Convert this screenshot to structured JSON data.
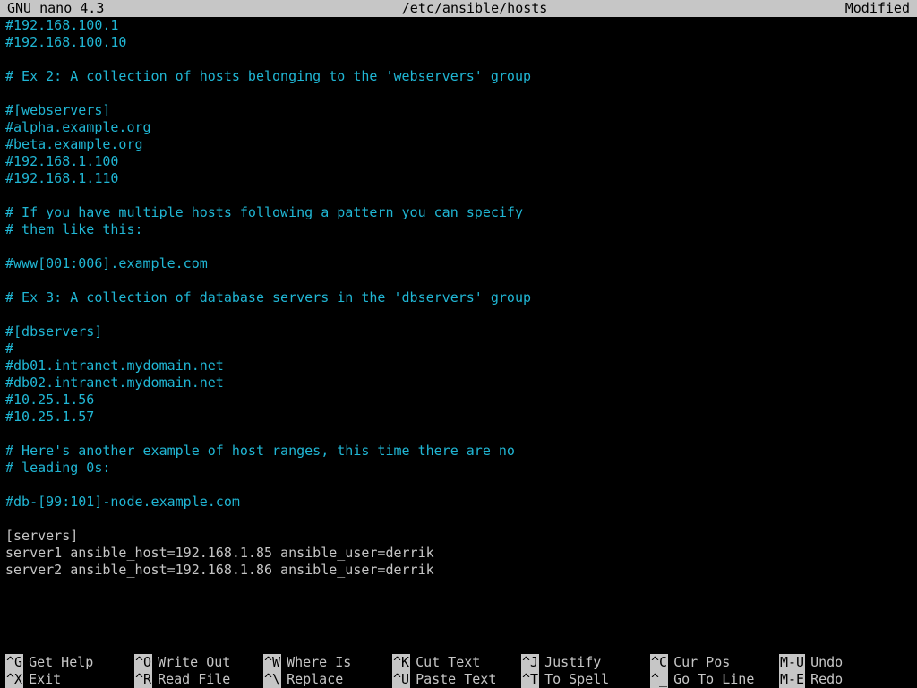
{
  "titlebar": {
    "app": "GNU nano 4.3",
    "file": "/etc/ansible/hosts",
    "state": "Modified"
  },
  "lines": [
    {
      "cls": "comment",
      "text": "#192.168.100.1"
    },
    {
      "cls": "comment",
      "text": "#192.168.100.10"
    },
    {
      "cls": "",
      "text": ""
    },
    {
      "cls": "comment",
      "text": "# Ex 2: A collection of hosts belonging to the 'webservers' group"
    },
    {
      "cls": "",
      "text": ""
    },
    {
      "cls": "comment",
      "text": "#[webservers]"
    },
    {
      "cls": "comment",
      "text": "#alpha.example.org"
    },
    {
      "cls": "comment",
      "text": "#beta.example.org"
    },
    {
      "cls": "comment",
      "text": "#192.168.1.100"
    },
    {
      "cls": "comment",
      "text": "#192.168.1.110"
    },
    {
      "cls": "",
      "text": ""
    },
    {
      "cls": "comment",
      "text": "# If you have multiple hosts following a pattern you can specify"
    },
    {
      "cls": "comment",
      "text": "# them like this:"
    },
    {
      "cls": "",
      "text": ""
    },
    {
      "cls": "comment",
      "text": "#www[001:006].example.com"
    },
    {
      "cls": "",
      "text": ""
    },
    {
      "cls": "comment",
      "text": "# Ex 3: A collection of database servers in the 'dbservers' group"
    },
    {
      "cls": "",
      "text": ""
    },
    {
      "cls": "comment",
      "text": "#[dbservers]"
    },
    {
      "cls": "comment",
      "text": "#"
    },
    {
      "cls": "comment",
      "text": "#db01.intranet.mydomain.net"
    },
    {
      "cls": "comment",
      "text": "#db02.intranet.mydomain.net"
    },
    {
      "cls": "comment",
      "text": "#10.25.1.56"
    },
    {
      "cls": "comment",
      "text": "#10.25.1.57"
    },
    {
      "cls": "",
      "text": ""
    },
    {
      "cls": "comment",
      "text": "# Here's another example of host ranges, this time there are no"
    },
    {
      "cls": "comment",
      "text": "# leading 0s:"
    },
    {
      "cls": "",
      "text": ""
    },
    {
      "cls": "comment",
      "text": "#db-[99:101]-node.example.com"
    },
    {
      "cls": "",
      "text": ""
    },
    {
      "cls": "",
      "text": "[servers]"
    },
    {
      "cls": "",
      "text": "server1 ansible_host=192.168.1.85 ansible_user=derrik"
    },
    {
      "cls": "",
      "text": "server2 ansible_host=192.168.1.86 ansible_user=derrik"
    },
    {
      "cls": "",
      "text": ""
    }
  ],
  "shortcuts": {
    "row1": [
      {
        "key": "^G",
        "label": "Get Help"
      },
      {
        "key": "^O",
        "label": "Write Out"
      },
      {
        "key": "^W",
        "label": "Where Is"
      },
      {
        "key": "^K",
        "label": "Cut Text"
      },
      {
        "key": "^J",
        "label": "Justify"
      },
      {
        "key": "^C",
        "label": "Cur Pos"
      },
      {
        "key": "M-U",
        "label": "Undo"
      }
    ],
    "row2": [
      {
        "key": "^X",
        "label": "Exit"
      },
      {
        "key": "^R",
        "label": "Read File"
      },
      {
        "key": "^\\",
        "label": "Replace"
      },
      {
        "key": "^U",
        "label": "Paste Text"
      },
      {
        "key": "^T",
        "label": "To Spell"
      },
      {
        "key": "^_",
        "label": "Go To Line"
      },
      {
        "key": "M-E",
        "label": "Redo"
      }
    ]
  }
}
